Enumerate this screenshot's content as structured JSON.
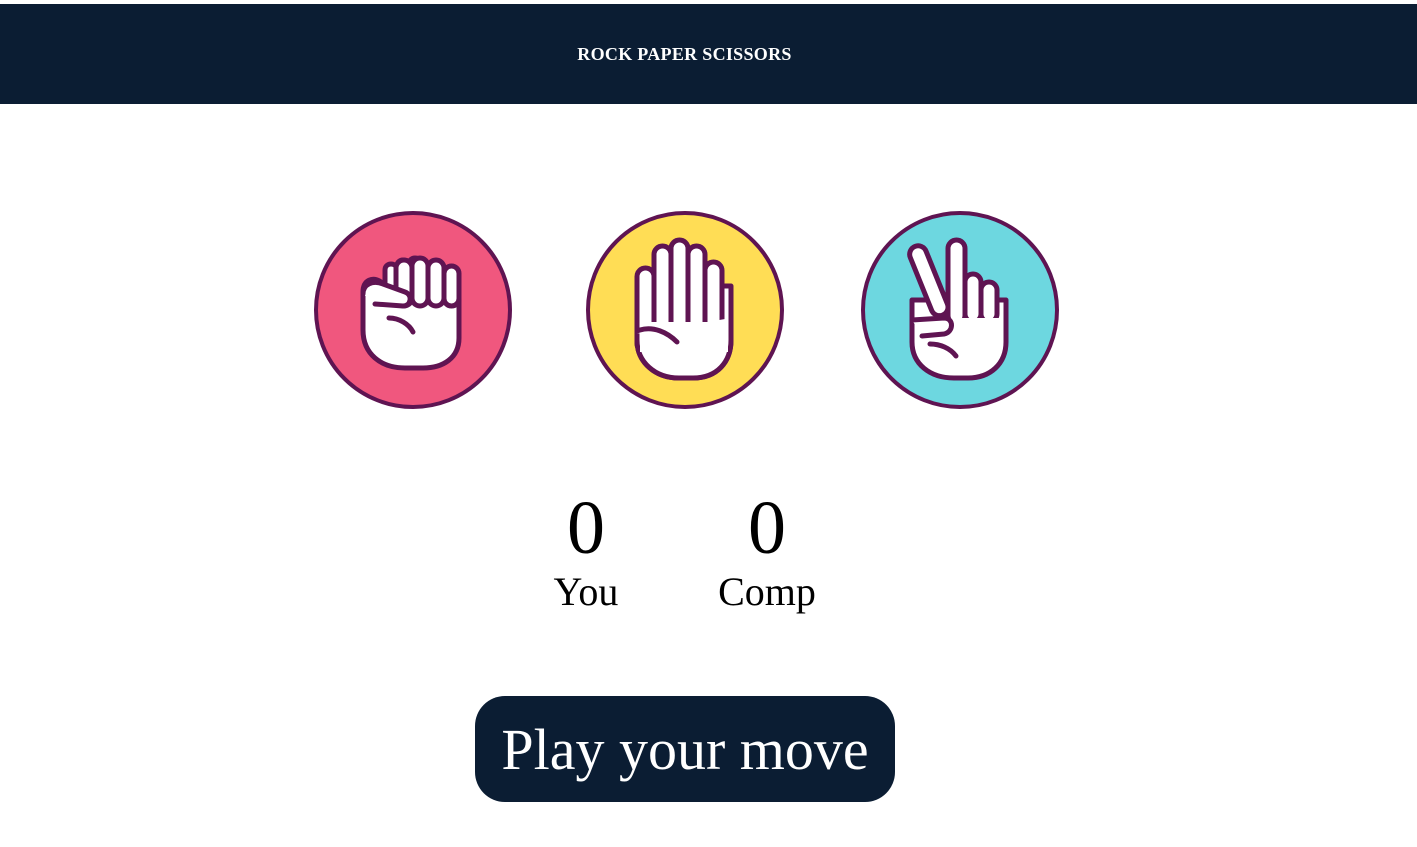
{
  "header": {
    "title": "ROCK PAPER SCISSORS"
  },
  "choices": [
    {
      "name": "rock",
      "icon": "rock-fist-icon",
      "color": "#f0577e"
    },
    {
      "name": "paper",
      "icon": "paper-hand-icon",
      "color": "#ffdd55"
    },
    {
      "name": "scissors",
      "icon": "scissors-hand-icon",
      "color": "#6dd7e0"
    }
  ],
  "score": {
    "you": {
      "value": "0",
      "label": "You"
    },
    "comp": {
      "value": "0",
      "label": "Comp"
    }
  },
  "play_button": {
    "label": "Play your move"
  },
  "colors": {
    "header_bg": "#0b1d33",
    "outline": "#5f1452",
    "button_bg": "#0b1d33"
  }
}
